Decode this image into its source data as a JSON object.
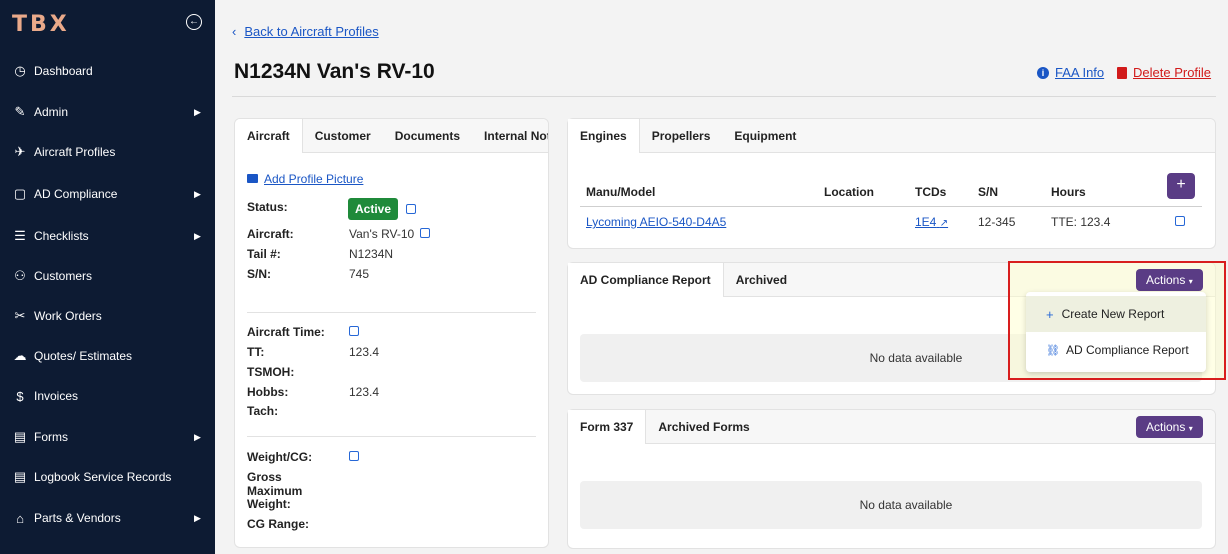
{
  "sidebar": {
    "logo": "TBX",
    "items": [
      {
        "label": "Dashboard",
        "icon": "dashboard-icon",
        "glyph": "◷",
        "arrow": false
      },
      {
        "label": "Admin",
        "icon": "admin-icon",
        "glyph": "✎",
        "arrow": true
      },
      {
        "label": "Aircraft Profiles",
        "icon": "airplane-icon",
        "glyph": "✈",
        "arrow": false
      },
      {
        "label": "AD Compliance",
        "icon": "document-icon",
        "glyph": "▢",
        "arrow": true
      },
      {
        "label": "Checklists",
        "icon": "checklist-icon",
        "glyph": "☰",
        "arrow": true
      },
      {
        "label": "Customers",
        "icon": "customers-icon",
        "glyph": "⚇",
        "arrow": false
      },
      {
        "label": "Work Orders",
        "icon": "tools-icon",
        "glyph": "✂",
        "arrow": false
      },
      {
        "label": "Quotes/ Estimates",
        "icon": "quotes-icon",
        "glyph": "☁",
        "arrow": false
      },
      {
        "label": "Invoices",
        "icon": "invoice-icon",
        "glyph": "$",
        "arrow": false
      },
      {
        "label": "Forms",
        "icon": "forms-icon",
        "glyph": "▤",
        "arrow": true
      },
      {
        "label": "Logbook Service Records",
        "icon": "logbook-icon",
        "glyph": "▤",
        "arrow": false
      },
      {
        "label": "Parts & Vendors",
        "icon": "tag-icon",
        "glyph": "⌂",
        "arrow": true
      }
    ]
  },
  "header": {
    "back_label": "Back to Aircraft Profiles",
    "title": "N1234N Van's RV-10",
    "faa_info": "FAA Info",
    "delete_profile": "Delete Profile"
  },
  "aircraft_card": {
    "tabs": [
      "Aircraft",
      "Customer",
      "Documents",
      "Internal Note"
    ],
    "add_picture": "Add Profile Picture",
    "status_label": "Status:",
    "status_value": "Active",
    "aircraft_label": "Aircraft:",
    "aircraft_value": "Van's RV-10",
    "tail_label": "Tail #:",
    "tail_value": "N1234N",
    "sn_label": "S/N:",
    "sn_value": "745",
    "aircraft_time_label": "Aircraft Time:",
    "tt_label": "TT:",
    "tt_value": "123.4",
    "tsmoh_label": "TSMOH:",
    "hobbs_label": "Hobbs:",
    "hobbs_value": "123.4",
    "tach_label": "Tach:",
    "weight_label": "Weight/CG:",
    "gross_label_1": "Gross",
    "gross_label_2": "Maximum",
    "gross_label_3": "Weight:",
    "cg_label": "CG Range:"
  },
  "engines_card": {
    "tabs": [
      "Engines",
      "Propellers",
      "Equipment"
    ],
    "columns": [
      "Manu/Model",
      "Location",
      "TCDs",
      "S/N",
      "Hours"
    ],
    "row": {
      "model": "Lycoming AEIO-540-D4A5",
      "tcds": "1E4",
      "sn": "12-345",
      "hours": "TTE: 123.4"
    },
    "add_label": "+"
  },
  "ad_card": {
    "tabs": [
      "AD Compliance Report",
      "Archived"
    ],
    "actions_label": "Actions",
    "nodata": "No data available",
    "menu": [
      {
        "label": "Create New Report",
        "glyph": "+"
      },
      {
        "label": "AD Compliance Report",
        "glyph": "🔗"
      }
    ]
  },
  "form_card": {
    "tabs": [
      "Form 337",
      "Archived Forms"
    ],
    "actions_label": "Actions",
    "nodata": "No data available"
  },
  "colors": {
    "sidebar_bg": "#0d1b33",
    "accent": "#5a3c85",
    "active_green": "#1f8a3a",
    "link": "#1a56c5",
    "danger": "#d11a1a"
  }
}
